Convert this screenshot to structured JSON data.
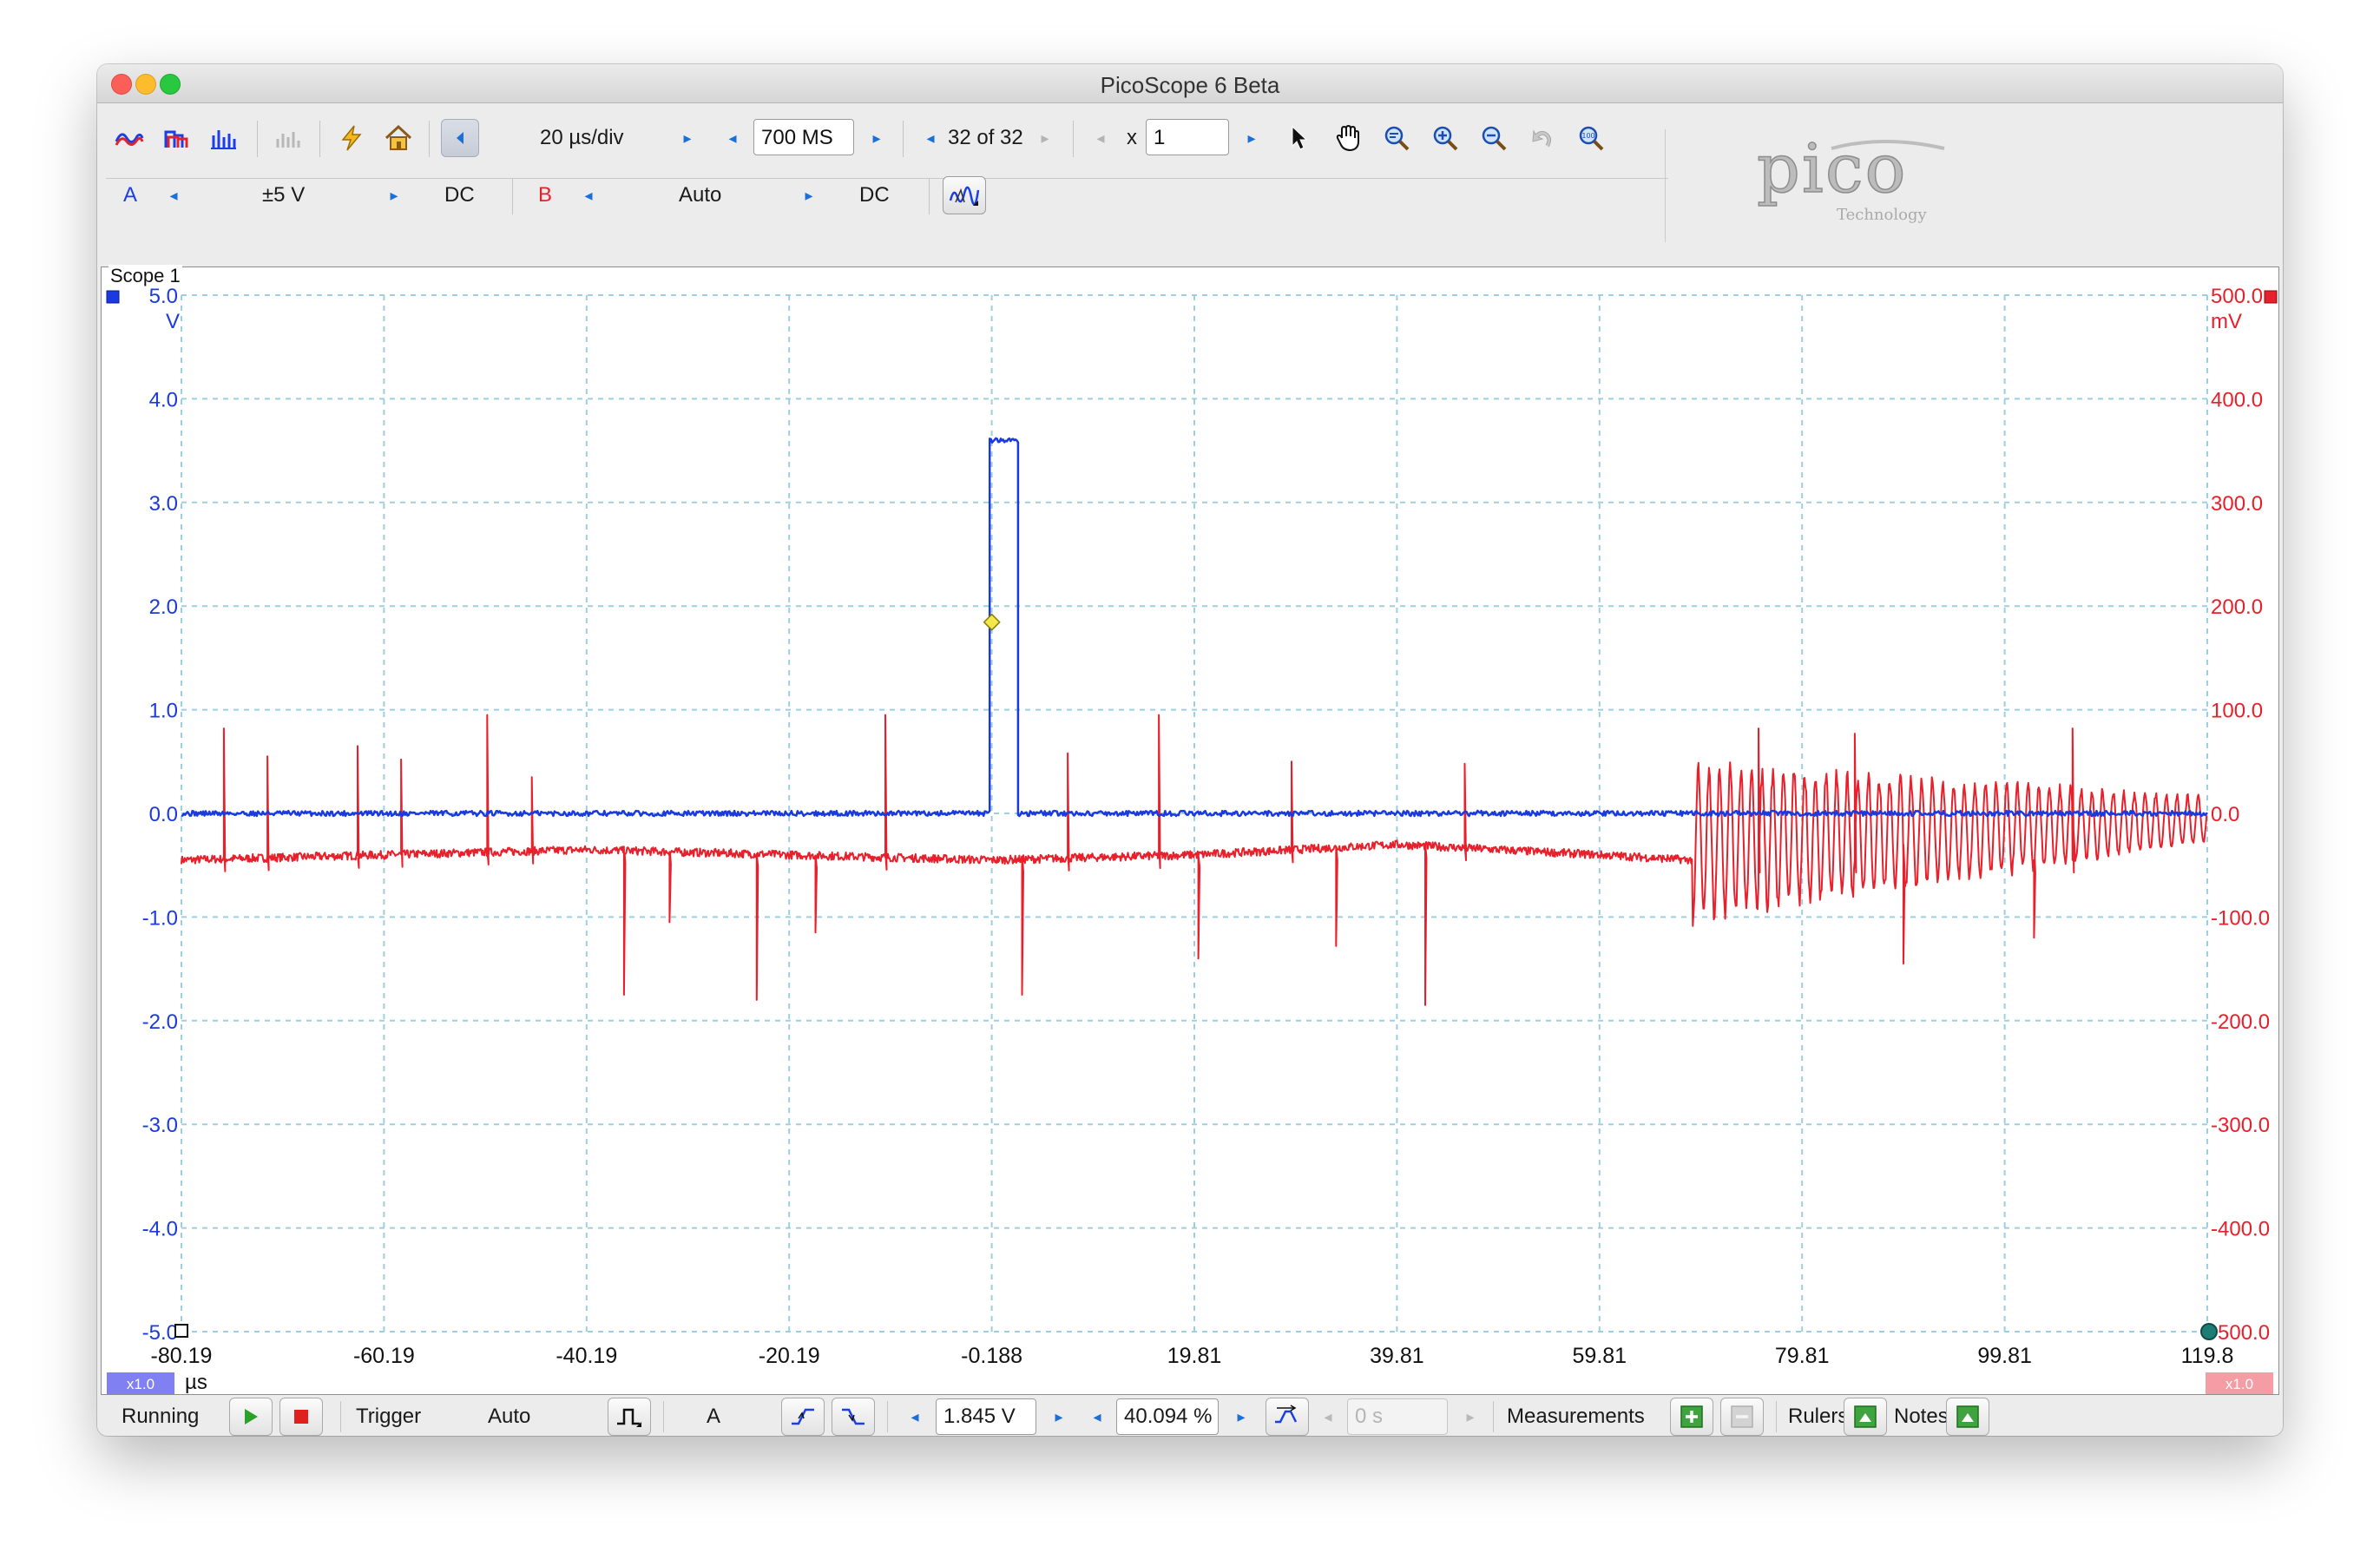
{
  "window": {
    "title": "PicoScope 6 Beta"
  },
  "toolbar": {
    "timebase": "20 µs/div",
    "samples": "700 MS",
    "buffer": "32 of 32",
    "zoom_prefix": "x",
    "zoom_value": "1",
    "icons": [
      "scope-view-icon",
      "persistence-view-icon",
      "spectrum-view-icon",
      "spectrum-view-disabled-icon",
      "auto-setup-icon",
      "home-icon",
      "back-icon",
      "pointer-icon",
      "hand-icon",
      "zoom-icon",
      "zoom-in-icon",
      "zoom-out-icon",
      "undo-zoom-icon",
      "zoom-overview-icon"
    ]
  },
  "channels": {
    "a": {
      "label": "A",
      "range": "±5 V",
      "coupling": "DC",
      "color": "#1a3ae0"
    },
    "b": {
      "label": "B",
      "range": "Auto",
      "coupling": "DC",
      "color": "#e8202b"
    },
    "math_button": "math-channel-icon"
  },
  "logo": {
    "name": "pico",
    "sub": "Technology"
  },
  "scope": {
    "label": "Scope 1",
    "left_unit": "V",
    "right_unit": "mV",
    "time_unit": "µs",
    "left_scale_badge": "x1.0",
    "right_scale_badge": "x1.0",
    "left_ticks": [
      "5.0",
      "4.0",
      "3.0",
      "2.0",
      "1.0",
      "0.0",
      "-1.0",
      "-2.0",
      "-3.0",
      "-4.0",
      "-5.0"
    ],
    "right_ticks": [
      "500.0",
      "400.0",
      "300.0",
      "200.0",
      "100.0",
      "0.0",
      "-100.0",
      "-200.0",
      "-300.0",
      "-400.0",
      "-500.0"
    ],
    "x_ticks": [
      "-80.19",
      "-60.19",
      "-40.19",
      "-20.19",
      "-0.188",
      "19.81",
      "39.81",
      "59.81",
      "79.81",
      "99.81",
      "119.8"
    ],
    "grid": true
  },
  "chart_data": {
    "type": "line",
    "title": "",
    "xlabel": "µs",
    "ylabel": "V",
    "xlim": [
      -80.19,
      119.8
    ],
    "ylim": [
      -5.0,
      5.0
    ],
    "y2lim": [
      -500.0,
      500.0
    ],
    "y2label": "mV",
    "grid": true,
    "series": [
      {
        "name": "A",
        "color": "#1a3ae0",
        "axis": "left",
        "x": [
          -80.19,
          -0.4,
          -0.4,
          2.4,
          2.4,
          119.8
        ],
        "y": [
          0.0,
          0.0,
          3.6,
          3.6,
          0.0,
          0.0
        ]
      },
      {
        "name": "B",
        "color": "#e8202b",
        "axis": "right",
        "baseline_x": [
          -80.19,
          -40.19,
          -20.19,
          -0.188,
          19.81,
          39.81,
          59.81,
          69.0,
          119.8
        ],
        "baseline_y": [
          -45,
          -35,
          -40,
          -45,
          -40,
          -30,
          -40,
          -45,
          -45
        ],
        "positive_spikes": [
          {
            "x": -76.0,
            "y": 82
          },
          {
            "x": -71.7,
            "y": 55
          },
          {
            "x": -62.8,
            "y": 65
          },
          {
            "x": -58.5,
            "y": 52
          },
          {
            "x": -50.0,
            "y": 95
          },
          {
            "x": -45.6,
            "y": 35
          },
          {
            "x": -10.7,
            "y": 95
          },
          {
            "x": 7.3,
            "y": 58
          },
          {
            "x": 16.3,
            "y": 95
          },
          {
            "x": 29.4,
            "y": 50
          },
          {
            "x": 46.5,
            "y": 48
          },
          {
            "x": 75.5,
            "y": 82
          },
          {
            "x": 85.0,
            "y": 77
          },
          {
            "x": 106.5,
            "y": 82
          }
        ],
        "negative_spikes": [
          {
            "x": -36.5,
            "y": -175
          },
          {
            "x": -32.0,
            "y": -105
          },
          {
            "x": -23.4,
            "y": -180
          },
          {
            "x": -17.6,
            "y": -115
          },
          {
            "x": 2.8,
            "y": -175
          },
          {
            "x": 20.2,
            "y": -140
          },
          {
            "x": 33.8,
            "y": -128
          },
          {
            "x": 42.6,
            "y": -185
          },
          {
            "x": 89.8,
            "y": -145
          },
          {
            "x": 102.7,
            "y": -120
          }
        ],
        "oscillation": {
          "x_start": 69.0,
          "x_end": 119.8,
          "peak_start": 55,
          "peak_end": 18,
          "trough_start": -110,
          "trough_end": -30
        }
      }
    ]
  },
  "trigger_marker": {
    "x": -0.188,
    "y": 1.845,
    "color": "#f2e84a"
  },
  "bottom": {
    "run_status": "Running",
    "trigger_label": "Trigger",
    "trigger_mode": "Auto",
    "trigger_source": "A",
    "threshold": "1.845 V",
    "pre_trigger": "40.094 %",
    "delay": "0 s",
    "measurements_label": "Measurements",
    "rulers_label": "Rulers",
    "notes_label": "Notes"
  }
}
